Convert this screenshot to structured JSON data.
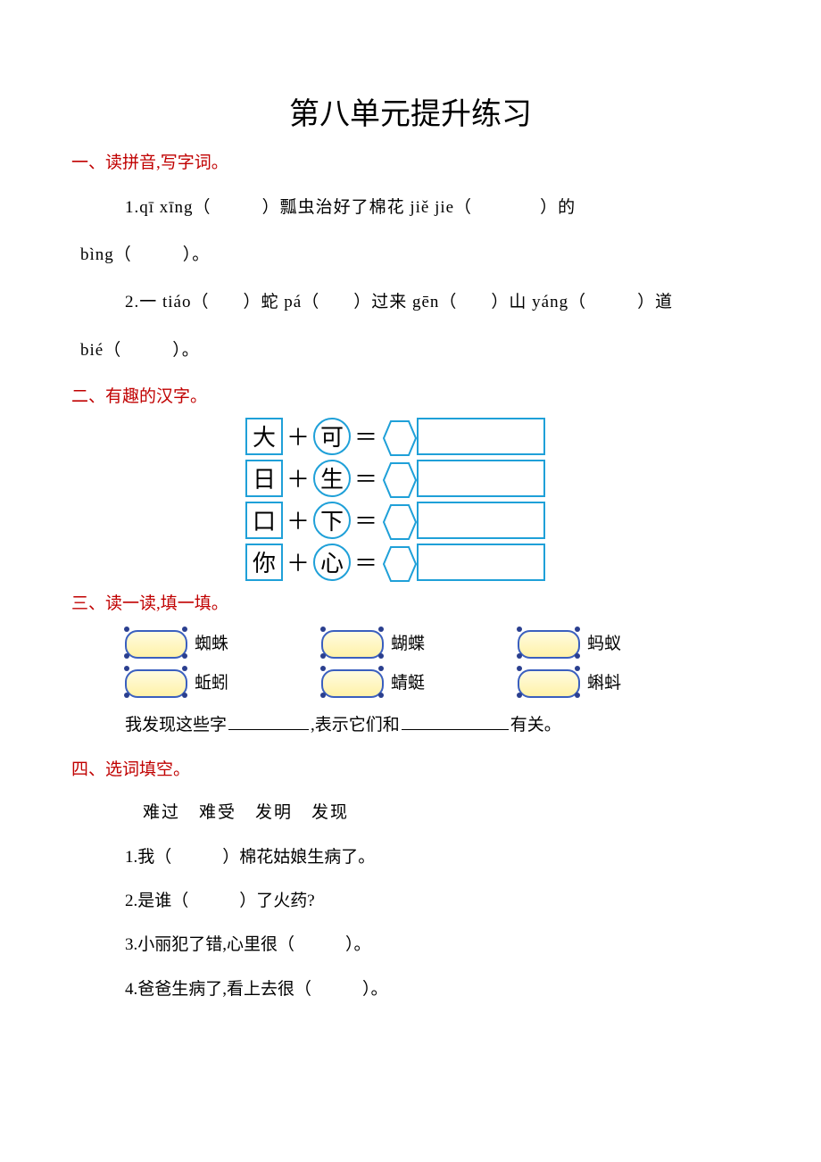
{
  "title": "第八单元提升练习",
  "s1": {
    "head": "一、读拼音,写字词。",
    "line1_a": "1.qī xīng（",
    "line1_b": "）瓢虫治好了棉花 jiě jie（",
    "line1_c": "）的",
    "line1_d": "bìng（",
    "line1_e": "）。",
    "line2_a": "2.一 tiáo（",
    "line2_b": "）蛇 pá（",
    "line2_c": "）过来 gēn（",
    "line2_d": "）山 yáng（",
    "line2_e": "）道",
    "line2_f": "bié（",
    "line2_g": "）。"
  },
  "s2": {
    "head": "二、有趣的汉字。",
    "plus": "＋",
    "eq": "＝",
    "rows": [
      {
        "left": "大",
        "right": "可"
      },
      {
        "left": "日",
        "right": "生"
      },
      {
        "left": "口",
        "right": "下"
      },
      {
        "left": "你",
        "right": "心"
      }
    ]
  },
  "s3": {
    "head": "三、读一读,填一填。",
    "row1": [
      "蜘蛛",
      "蝴蝶",
      "蚂蚁"
    ],
    "row2": [
      "蚯蚓",
      "蜻蜓",
      "蝌蚪"
    ],
    "fill_a": "我发现这些字",
    "fill_b": ",表示它们和",
    "fill_c": "有关。"
  },
  "s4": {
    "head": "四、选词填空。",
    "bank": "难过　难受　发明　发现",
    "q1_a": "1.我（",
    "q1_b": "）棉花姑娘生病了。",
    "q2_a": "2.是谁（",
    "q2_b": "）了火药?",
    "q3_a": "3.小丽犯了错,心里很（",
    "q3_b": "）。",
    "q4_a": "4.爸爸生病了,看上去很（",
    "q4_b": "）。"
  }
}
